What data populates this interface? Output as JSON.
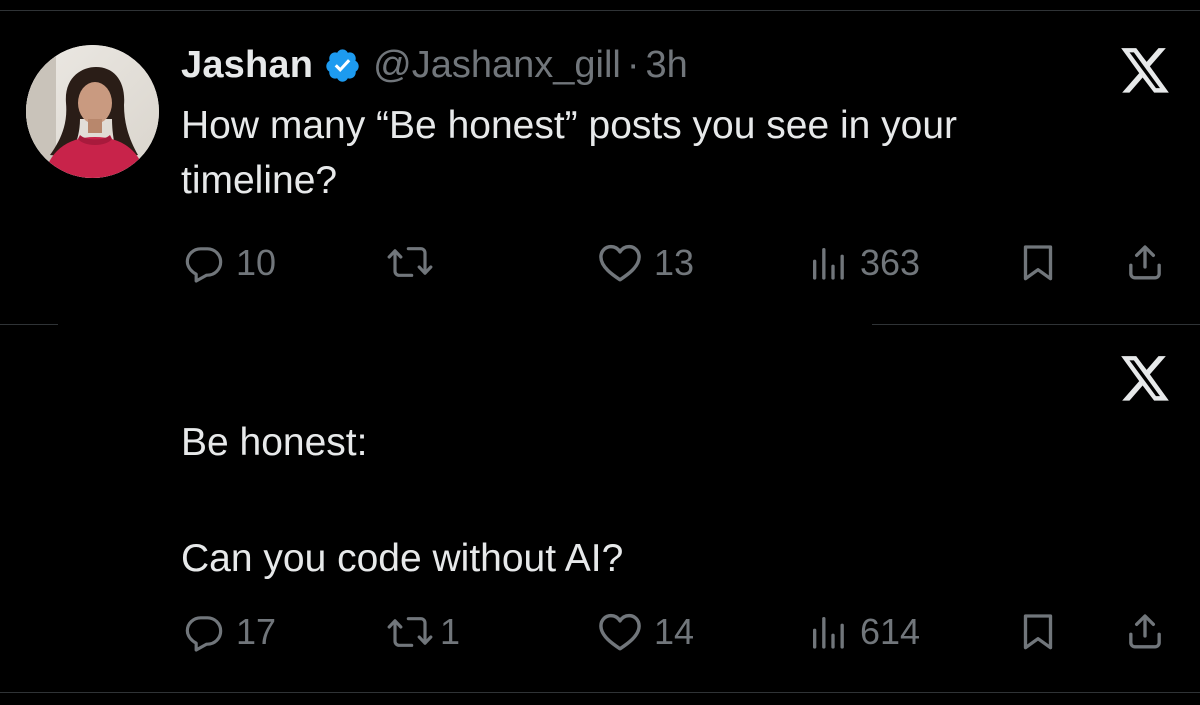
{
  "colors": {
    "background": "#000000",
    "primary_text": "#e7e9ea",
    "secondary_text": "#71767b",
    "verified_blue": "#1d9bf0",
    "divider": "#2f3336"
  },
  "post1": {
    "author_name": "Jashan",
    "author_handle": "@Jashanx_gill",
    "separator": "·",
    "time": "3h",
    "text": "How many “Be honest” posts you see in your\ntimeline?",
    "replies": "10",
    "retweets": "",
    "likes": "13",
    "views": "363"
  },
  "post2": {
    "text": "Be honest:\n\nCan you code without AI?",
    "replies": "17",
    "retweets": "1",
    "likes": "14",
    "views": "614"
  },
  "icons": {
    "platform": "x-logo-icon",
    "reply": "reply-bubble-icon",
    "retweet": "retweet-icon",
    "like": "heart-icon",
    "views": "bar-chart-icon",
    "bookmark": "bookmark-icon",
    "share": "share-icon",
    "verified": "verified-badge-icon"
  }
}
